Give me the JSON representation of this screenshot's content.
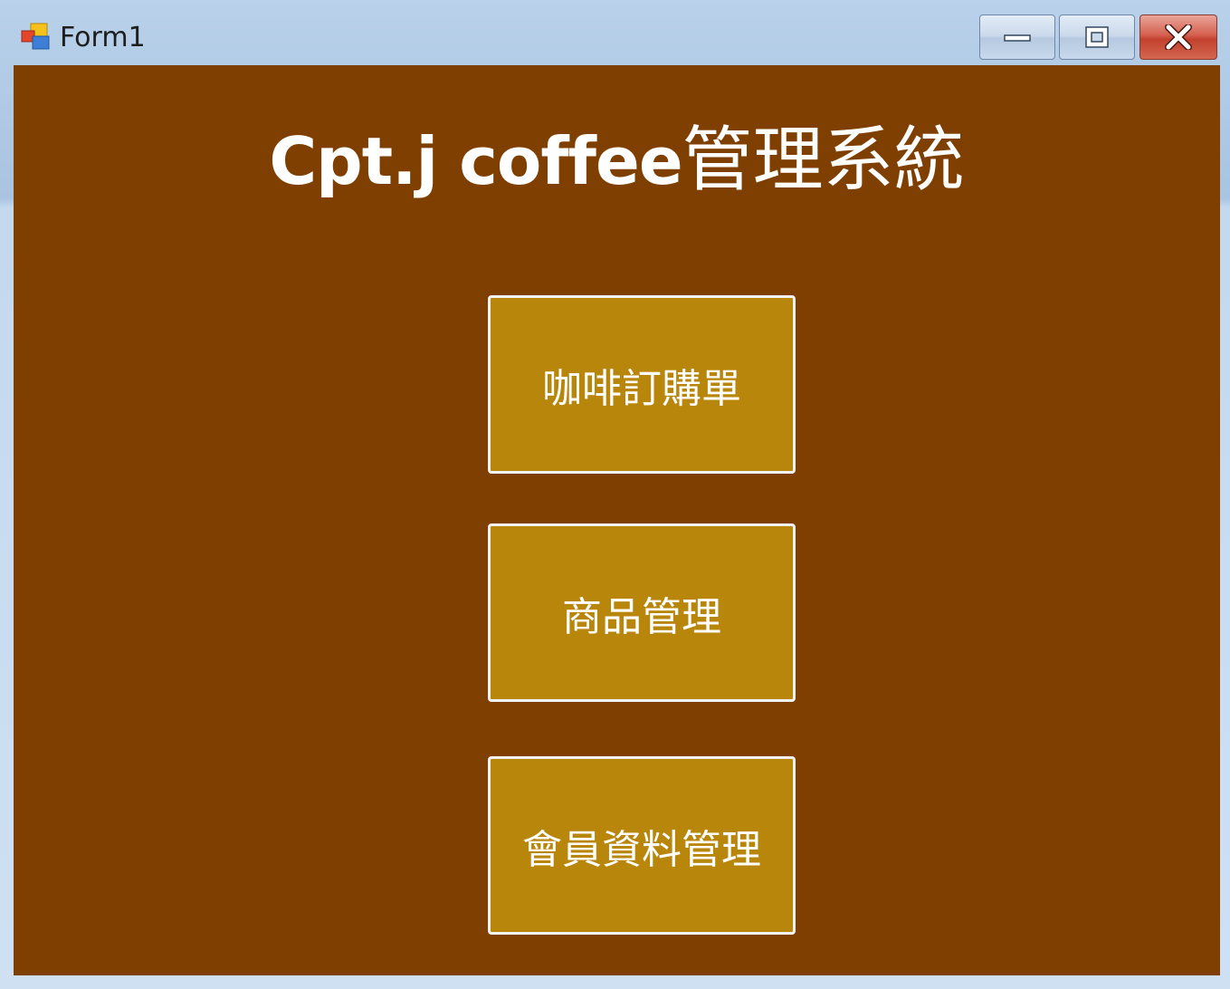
{
  "window": {
    "title": "Form1",
    "icon": "winforms-app-icon",
    "controls": {
      "minimize_icon": "minimize-icon",
      "maximize_icon": "maximize-icon",
      "close_icon": "close-icon"
    }
  },
  "main": {
    "heading_en": "Cpt.j coffee",
    "heading_zh": "管理系統",
    "buttons": [
      {
        "label": "咖啡訂購單"
      },
      {
        "label": "商品管理"
      },
      {
        "label": "會員資料管理"
      }
    ]
  },
  "colors": {
    "background": "#7f3f00",
    "button_fill": "#b8860b",
    "button_border": "#f2f2f2",
    "text": "#ffffff"
  }
}
